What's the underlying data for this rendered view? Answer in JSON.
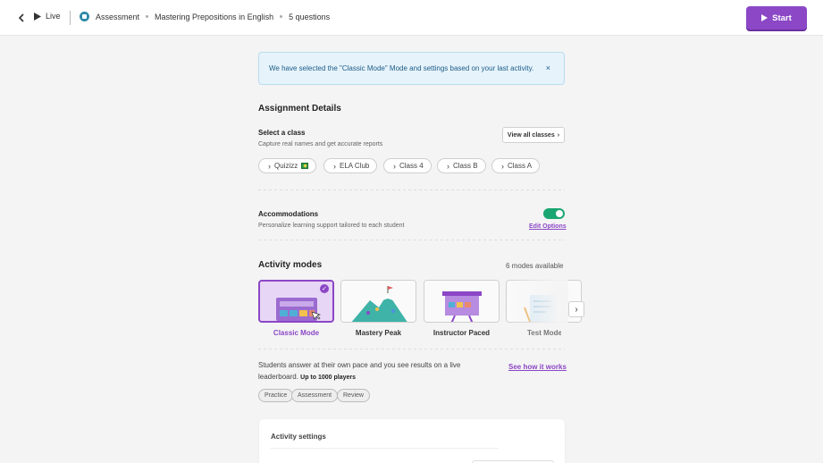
{
  "header": {
    "live_label": "Live",
    "breadcrumb": {
      "type_label": "Assessment",
      "title": "Mastering Prepositions in English",
      "count": "5 questions"
    },
    "start_label": "Start"
  },
  "banner": {
    "text": "We have selected the \"Classic Mode\" Mode and settings based on your last activity.",
    "close_glyph": "×"
  },
  "assignment": {
    "title": "Assignment Details",
    "select_class_label": "Select a class",
    "select_class_sub": "Capture real names and get accurate reports",
    "view_all_label": "View all classes",
    "classes": [
      "Quizizz",
      "ELA Club",
      "Class 4",
      "Class B",
      "Class A"
    ]
  },
  "accommodations": {
    "title": "Accommodations",
    "subtitle": "Personalize learning support tailored to each student",
    "edit_label": "Edit Options",
    "enabled": true
  },
  "activity_modes": {
    "title": "Activity modes",
    "count_label": "6 modes available",
    "modes": [
      "Classic Mode",
      "Mastery Peak",
      "Instructor Paced",
      "Test Mode"
    ],
    "selected": "Classic Mode",
    "description": "Students answer at their own pace and you see results on a live leaderboard.",
    "players_label": "Up to 1000 players",
    "how_link": "See how it works",
    "tags": [
      "Practice",
      "Assessment",
      "Review"
    ]
  },
  "settings": {
    "title": "Activity settings"
  },
  "colors": {
    "accent": "#8b47c6",
    "toggle_on": "#1aa672",
    "banner_bg": "#e6f3fb",
    "banner_text": "#1c5c86"
  }
}
